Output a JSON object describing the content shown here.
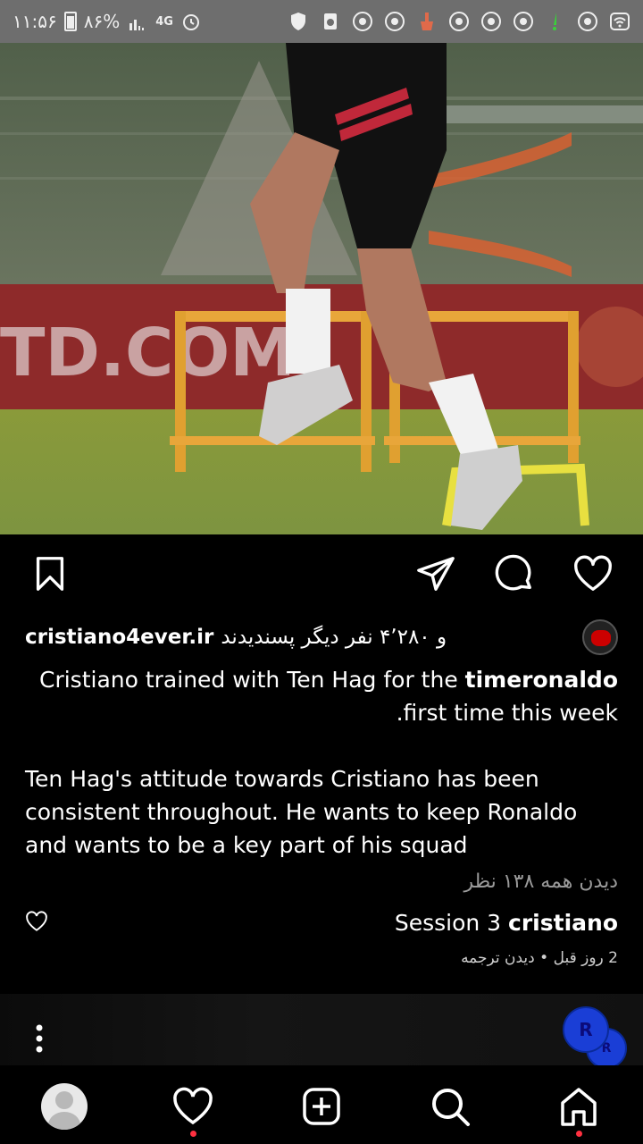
{
  "status_bar": {
    "time": "۱۱:۵۶",
    "battery_percent": "۸۶%",
    "network": "4G",
    "icons": [
      "battery-icon",
      "signal-icon",
      "alarm-icon",
      "shield-icon",
      "cleaner-icon",
      "broom-icon",
      "chrome-icon",
      "wifi-icon"
    ]
  },
  "post": {
    "image_alt": "Football player training with hurdles",
    "photo_text": "TD.COM",
    "likes": {
      "text_rtl": "و ۴٬۲۸۰ نفر دیگر پسندیدند",
      "username": "cristiano4ever.ir"
    },
    "caption": {
      "username": "timeronaldo",
      "line1": "Cristiano trained with Ten Hag for the",
      "line2": ".first time this week",
      "paragraph": "Ten Hag's attitude towards Cristiano has been consistent throughout. He wants to keep Ronaldo and wants to be a key part of his squad"
    },
    "view_all_comments": "دیدن همه ۱۳۸ نظر",
    "comment": {
      "username": "cristiano",
      "text": "Session 3"
    },
    "meta": {
      "time_ago": "2 روز قبل",
      "separator": " • ",
      "see_translation": "دیدن ترجمه"
    }
  },
  "next_post": {
    "badge_text": "R"
  },
  "colors": {
    "background": "#000000",
    "notification_dot": "#ff3040",
    "badge_blue": "#1a3ed6"
  }
}
